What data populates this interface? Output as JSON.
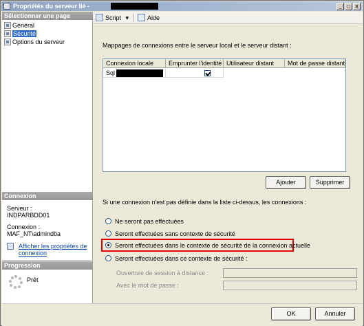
{
  "window": {
    "title": "Propriétés du serveur lié -"
  },
  "sidebar": {
    "select_page_header": "Sélectionner une page",
    "items": [
      {
        "label": "Général",
        "selected": false
      },
      {
        "label": "Sécurité",
        "selected": true
      },
      {
        "label": "Options du serveur",
        "selected": false
      }
    ],
    "connection_header": "Connexion",
    "server_label": "Serveur :",
    "server_value": "INDPARBDD01",
    "connection_label": "Connexion :",
    "connection_value": "MAF_NT\\admindba",
    "view_props_link_line1": "Afficher les propriétés de",
    "view_props_link_line2": "connexion",
    "progress_header": "Progression",
    "progress_status": "Prêt"
  },
  "toolbar": {
    "script_label": "Script",
    "help_label": "Aide"
  },
  "main": {
    "mappings_label": "Mappages de connexions entre le serveur local et le serveur distant :",
    "columns": [
      "Connexion locale",
      "Emprunter l'identité",
      "Utilisateur distant",
      "Mot de passe distant"
    ],
    "rows": [
      {
        "local_login": "Sql",
        "impersonate": true,
        "remote_user": "",
        "remote_password": ""
      }
    ],
    "add_button": "Ajouter",
    "remove_button": "Supprimer",
    "not_defined_label": "Si une connexion n'est pas définie dans la liste ci-dessus, les connexions :",
    "options": [
      {
        "label": "Ne seront pas effectuées",
        "selected": false
      },
      {
        "label": "Seront effectuées sans contexte de sécurité",
        "selected": false
      },
      {
        "label": "Seront effectuées dans le contexte de sécurité de la connexion actuelle",
        "selected": true
      },
      {
        "label": "Seront effectuées dans ce contexte de sécurité :",
        "selected": false
      }
    ],
    "remote_login_label": "Ouverture de session à distance :",
    "with_password_label": "Avec le mot de passe :"
  },
  "footer": {
    "ok_button": "OK",
    "cancel_button": "Annuler"
  }
}
